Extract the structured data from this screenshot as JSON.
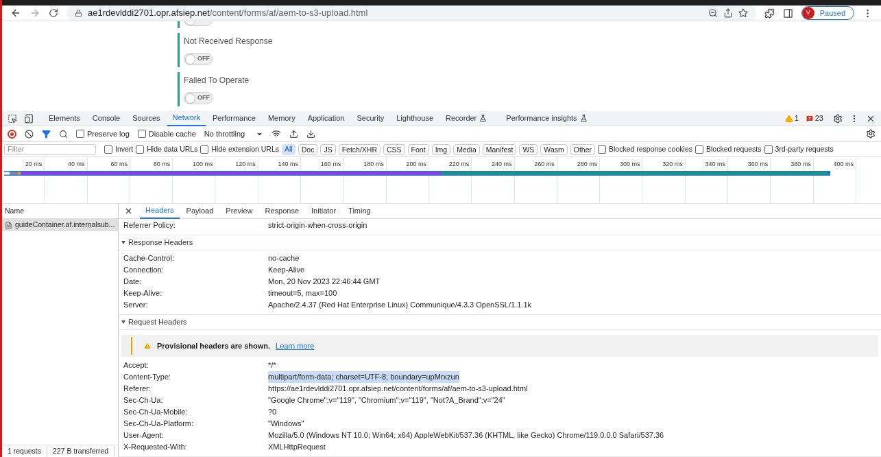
{
  "browser": {
    "url_host": "ae1rdevlddi2701.opr.afsiep.net",
    "url_path": "/content/forms/af/aem-to-s3-upload.html",
    "profile_initial": "V",
    "profile_status": "Paused"
  },
  "page": {
    "fields": [
      {
        "toggle": {
          "on": false
        }
      },
      {
        "label": "Not Received Response",
        "toggle": {
          "on": false,
          "text": "OFF"
        }
      },
      {
        "label": "Failed To Operate",
        "toggle": {
          "on": false,
          "text": "OFF"
        }
      }
    ]
  },
  "devtools": {
    "tabs": [
      {
        "label": "Elements",
        "selected": false,
        "experimental": false
      },
      {
        "label": "Console",
        "selected": false,
        "experimental": false
      },
      {
        "label": "Sources",
        "selected": false,
        "experimental": false
      },
      {
        "label": "Network",
        "selected": true,
        "experimental": false
      },
      {
        "label": "Performance",
        "selected": false,
        "experimental": false
      },
      {
        "label": "Memory",
        "selected": false,
        "experimental": false
      },
      {
        "label": "Application",
        "selected": false,
        "experimental": false
      },
      {
        "label": "Security",
        "selected": false,
        "experimental": false
      },
      {
        "label": "Lighthouse",
        "selected": false,
        "experimental": false
      },
      {
        "label": "Recorder",
        "selected": false,
        "experimental": true
      },
      {
        "label": "Performance insights",
        "selected": false,
        "experimental": true
      }
    ],
    "warnings": "1",
    "errors": "23",
    "toolbar": {
      "recording": true,
      "filter_active": true,
      "checkboxes": [
        {
          "label": "Preserve log",
          "checked": false
        },
        {
          "label": "Disable cache",
          "checked": false
        }
      ],
      "throttling": "No throttling"
    },
    "filter": {
      "placeholder": "Filter",
      "checkboxes_left": [
        {
          "label": "Invert",
          "checked": false
        },
        {
          "label": "Hide data URLs",
          "checked": false
        },
        {
          "label": "Hide extension URLs",
          "checked": false
        }
      ],
      "types": [
        {
          "label": "All",
          "selected": true
        },
        {
          "label": "Doc",
          "selected": false
        },
        {
          "label": "JS",
          "selected": false
        },
        {
          "label": "Fetch/XHR",
          "selected": false
        },
        {
          "label": "CSS",
          "selected": false
        },
        {
          "label": "Font",
          "selected": false
        },
        {
          "label": "Img",
          "selected": false
        },
        {
          "label": "Media",
          "selected": false
        },
        {
          "label": "Manifest",
          "selected": false
        },
        {
          "label": "WS",
          "selected": false
        },
        {
          "label": "Wasm",
          "selected": false
        },
        {
          "label": "Other",
          "selected": false
        }
      ],
      "checkboxes_right": [
        {
          "label": "Blocked response cookies",
          "checked": false
        },
        {
          "label": "Blocked requests",
          "checked": false
        },
        {
          "label": "3rd-party requests",
          "checked": false
        }
      ]
    },
    "timeline_ticks": [
      "20 ms",
      "40 ms",
      "60 ms",
      "80 ms",
      "100 ms",
      "120 ms",
      "140 ms",
      "160 ms",
      "180 ms",
      "200 ms",
      "220 ms",
      "240 ms",
      "260 ms",
      "280 ms",
      "300 ms",
      "320 ms",
      "340 ms",
      "360 ms",
      "380 ms",
      "400 ms"
    ],
    "requests": {
      "column": "Name",
      "rows": [
        {
          "name": "guideContainer.af.internalsub...",
          "selected": true
        }
      ],
      "status": [
        "1 requests",
        "227 B transferred"
      ]
    },
    "detail_tabs": [
      {
        "label": "Headers",
        "selected": true
      },
      {
        "label": "Payload",
        "selected": false
      },
      {
        "label": "Preview",
        "selected": false
      },
      {
        "label": "Response",
        "selected": false
      },
      {
        "label": "Initiator",
        "selected": false
      },
      {
        "label": "Timing",
        "selected": false
      }
    ],
    "general_tail": [
      {
        "name": "Referrer Policy:",
        "value": "strict-origin-when-cross-origin",
        "highlighted": false
      }
    ],
    "sections": [
      {
        "title": "Response Headers",
        "expanded": true,
        "rows": [
          {
            "name": "Cache-Control:",
            "value": "no-cache",
            "highlighted": false
          },
          {
            "name": "Connection:",
            "value": "Keep-Alive",
            "highlighted": false
          },
          {
            "name": "Date:",
            "value": "Mon, 20 Nov 2023 22:46:44 GMT",
            "highlighted": false
          },
          {
            "name": "Keep-Alive:",
            "value": "timeout=5, max=100",
            "highlighted": false
          },
          {
            "name": "Server:",
            "value": "Apache/2.4.37 (Red Hat Enterprise Linux) Communique/4.3.3 OpenSSL/1.1.1k",
            "highlighted": false
          }
        ]
      },
      {
        "title": "Request Headers",
        "expanded": true,
        "notice": {
          "text": "Provisional headers are shown.",
          "link": "Learn more"
        },
        "rows": [
          {
            "name": "Accept:",
            "value": "*/*",
            "highlighted": false
          },
          {
            "name": "Content-Type:",
            "value": "multipart/form-data; charset=UTF-8; boundary=upMrxzun",
            "highlighted": true
          },
          {
            "name": "Referer:",
            "value": "https://ae1rdevlddi2701.opr.afsiep.net/content/forms/af/aem-to-s3-upload.html",
            "highlighted": false
          },
          {
            "name": "Sec-Ch-Ua:",
            "value": "\"Google Chrome\";v=\"119\", \"Chromium\";v=\"119\", \"Not?A_Brand\";v=\"24\"",
            "highlighted": false
          },
          {
            "name": "Sec-Ch-Ua-Mobile:",
            "value": "?0",
            "highlighted": false
          },
          {
            "name": "Sec-Ch-Ua-Platform:",
            "value": "\"Windows\"",
            "highlighted": false
          },
          {
            "name": "User-Agent:",
            "value": "Mozilla/5.0 (Windows NT 10.0; Win64; x64) AppleWebKit/537.36 (KHTML, like Gecko) Chrome/119.0.0.0 Safari/537.36",
            "highlighted": false
          },
          {
            "name": "X-Requested-With:",
            "value": "XMLHttpRequest",
            "highlighted": false
          }
        ]
      }
    ]
  }
}
